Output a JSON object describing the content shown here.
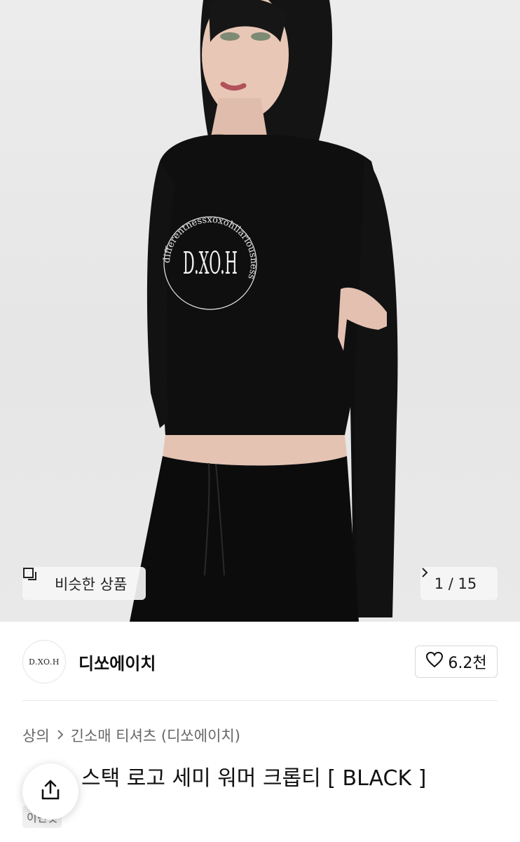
{
  "gallery": {
    "similar_label": "비슷한 상품",
    "pager_text": "1 / 15",
    "chest_logo_text": "D.XO.H",
    "chest_ring_text": "differentnessxoxohilariousness"
  },
  "brand": {
    "logo_text": "D.XO.H",
    "name": "디쏘에이치",
    "like_count": "6.2천"
  },
  "breadcrumb": {
    "category": "상의",
    "subcategory": "긴소매 티셔츠 (디쏘에이치)"
  },
  "product": {
    "title": "스택 로고 세미 워머 크롭티 [ BLACK ]",
    "tag": "이번것"
  },
  "colors": {
    "background": "#ffffff",
    "badge_bg": "#f5f5f5",
    "text_primary": "#111111",
    "text_secondary": "#666666"
  }
}
